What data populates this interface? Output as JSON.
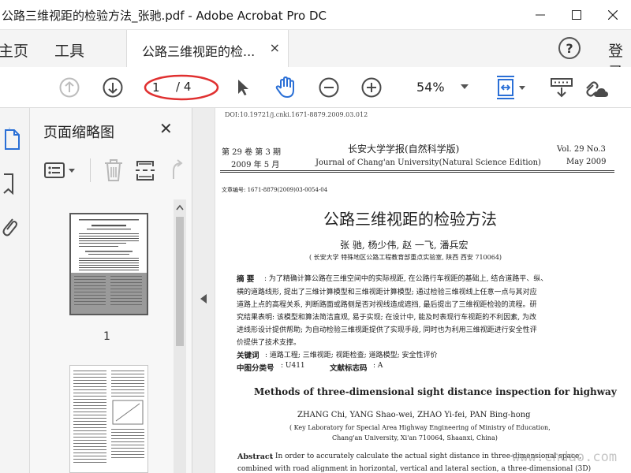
{
  "window": {
    "title": "公路三维视距的检验方法_张驰.pdf - Adobe Acrobat Pro DC",
    "minimize": "—",
    "maximize": "☐",
    "close": "✕"
  },
  "menu": {
    "home": "主页",
    "tools": "工具",
    "help": "?",
    "signin": "登录"
  },
  "tab": {
    "label": "公路三维视距的检...",
    "close": "×"
  },
  "toolbar": {
    "page_current": "1",
    "page_total": "/ 4",
    "zoom": "54%",
    "colors": {
      "icon": "#5f5f5f",
      "disabled": "#bdbdbd",
      "accent": "#2a6fd6",
      "annotation": "#e03030"
    }
  },
  "thumbnails": {
    "title": "页面缩略图",
    "close": "✕",
    "page1_label": "1"
  },
  "document": {
    "doi": "DOI:10.19721/j.cnki.1671-8879.2009.03.012",
    "volume_left": "第 29 卷  第 3 期",
    "date_left": "2009 年 5 月",
    "journal_cn": "长安大学学报(自然科学版)",
    "journal_en": "Journal of Chang'an University(Natural Science Edition)",
    "volume_right": "Vol. 29  No.3",
    "date_right": "May  2009",
    "article_no": "文章编号: 1671-8879(2009)03-0054-04",
    "title_cn": "公路三维视距的检验方法",
    "authors_cn": "张   驰, 杨少伟, 赵 一飞, 潘兵宏",
    "affiliation_cn": "( 长安大学 特殊地区公路工程教育部重点实验室, 陕西 西安 710064)",
    "abstract_label": "摘   要",
    "abstract_lines": [
      ": 为了精确计算公路在三维空间中的实际视距, 在公路行车视距的基础上, 结合道路平、纵、",
      "横的道路线形, 提出了三维计算模型和三维视距计算模型; 通过检验三维视线上任意一点与其对应",
      "道路上点的高程关系, 判断路面或路侧是否对视线造成遮挡, 最后提出了三维视距检验的流程。研",
      "究结果表明: 该模型和算法简洁直观, 易于实现; 在设计中, 能及时表现行车视距的不利因素, 为改",
      "进线形设计提供帮助; 为自动检验三维视距提供了实现手段, 同时也为利用三维视距进行安全性评",
      "价提供了技术支撑。"
    ],
    "keywords_label": "关键词",
    "keywords": ": 道路工程; 三维视距; 视距检查; 道路模型; 安全性评价",
    "clc_label": "中图分类号",
    "clc": ": U411",
    "doc_code_label": "文献标志码",
    "doc_code": ": A",
    "title_en": "Methods of three-dimensional sight distance inspection for highway",
    "authors_en": "ZHANG Chi,  YANG Shao-wei,  ZHAO Yi-fei,  PAN Bing-hong",
    "affiliation_en_1": "( Key Laboratory for Special Area Highway Engineering of Ministry of Education,",
    "affiliation_en_2": "Chang'an University,  Xi'an 710064,  Shaanxi,  China)",
    "abstract_en_label": "Abstract",
    "abstract_en_1": ": In order to accurately calculate the actual sight distance in three-dimensional space,",
    "abstract_en_2": "combined with road alignment in horizontal, vertical and lateral section, a three-dimensional (3D)"
  },
  "watermark": "www.cndao.com"
}
